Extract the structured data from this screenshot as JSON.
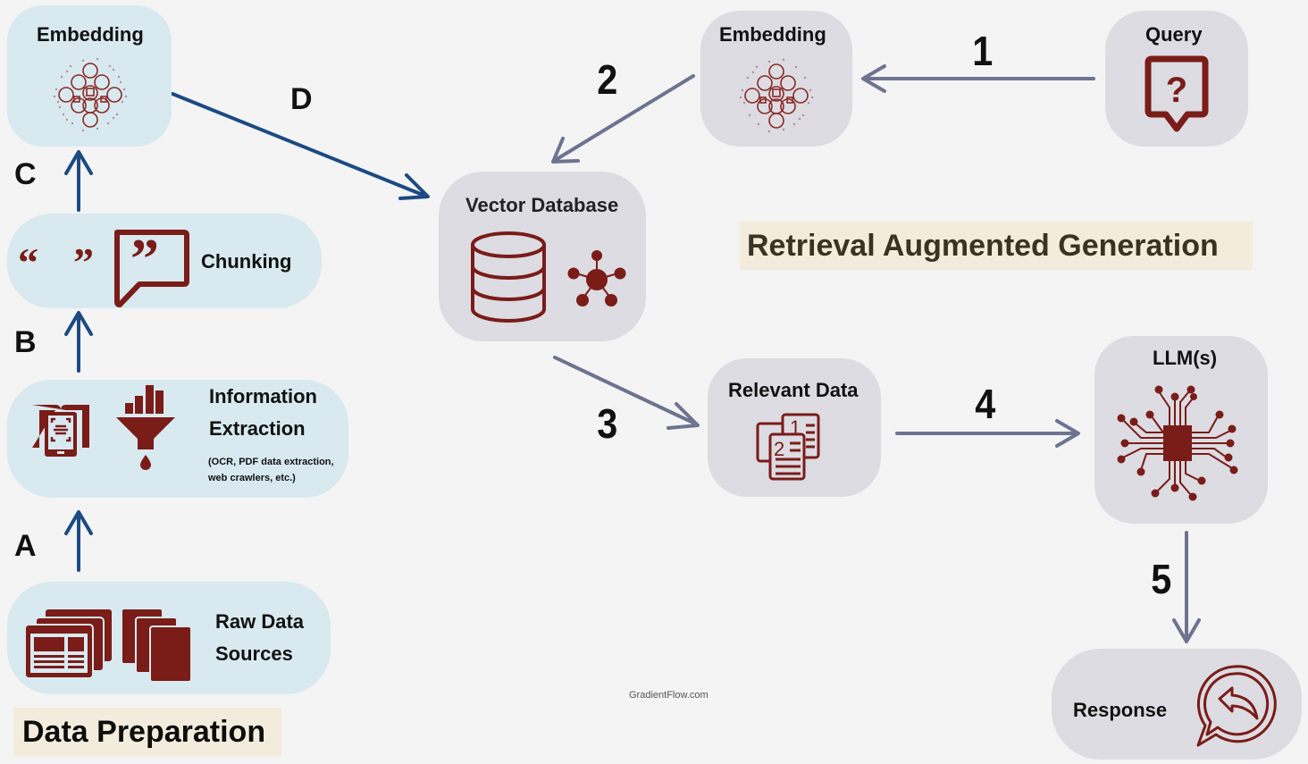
{
  "colors": {
    "prep_node_bg": "#d8e9f0",
    "rag_node_bg": "#dcdce2",
    "icon_red": "#7a1c18",
    "prep_arrow": "#1c4a82",
    "rag_arrow": "#6e7390",
    "banner_bg": "#f3ecdc",
    "page_bg": "#f4f4f4"
  },
  "sections": {
    "data_preparation": "Data Preparation",
    "rag": "Retrieval Augmented Generation"
  },
  "data_prep": {
    "raw": {
      "line1": "Raw Data",
      "line2": "Sources",
      "icons": [
        "web-pages-icon",
        "documents-stack-icon"
      ]
    },
    "extraction": {
      "line1": "Information",
      "line2": "Extraction",
      "note1": "(OCR, PDF data extraction,",
      "note2": "web crawlers, etc.)",
      "icons": [
        "tablet-scan-icon",
        "data-funnel-icon"
      ]
    },
    "chunking": {
      "label": "Chunking",
      "icons": [
        "open-quote-icon",
        "close-quote-icon",
        "quote-bubble-icon"
      ]
    },
    "embedding": {
      "label": "Embedding",
      "icon": "neural-embedding-icon"
    }
  },
  "rag": {
    "query": {
      "label": "Query",
      "icon": "question-bubble-icon"
    },
    "embedding": {
      "label": "Embedding",
      "icon": "neural-embedding-icon"
    },
    "vector_db": {
      "label": "Vector Database",
      "icons": [
        "database-icon",
        "network-hub-icon"
      ]
    },
    "relevant": {
      "label": "Relevant Data",
      "icon": "ranked-documents-icon"
    },
    "llm": {
      "label": "LLM(s)",
      "icon": "chip-circuit-icon"
    },
    "response": {
      "label": "Response",
      "icon": "reply-bubble-icon"
    }
  },
  "steps": {
    "A": "A",
    "B": "B",
    "C": "C",
    "D": "D",
    "s1": "1",
    "s2": "2",
    "s3": "3",
    "s4": "4",
    "s5": "5"
  },
  "watermark": "GradientFlow.com"
}
